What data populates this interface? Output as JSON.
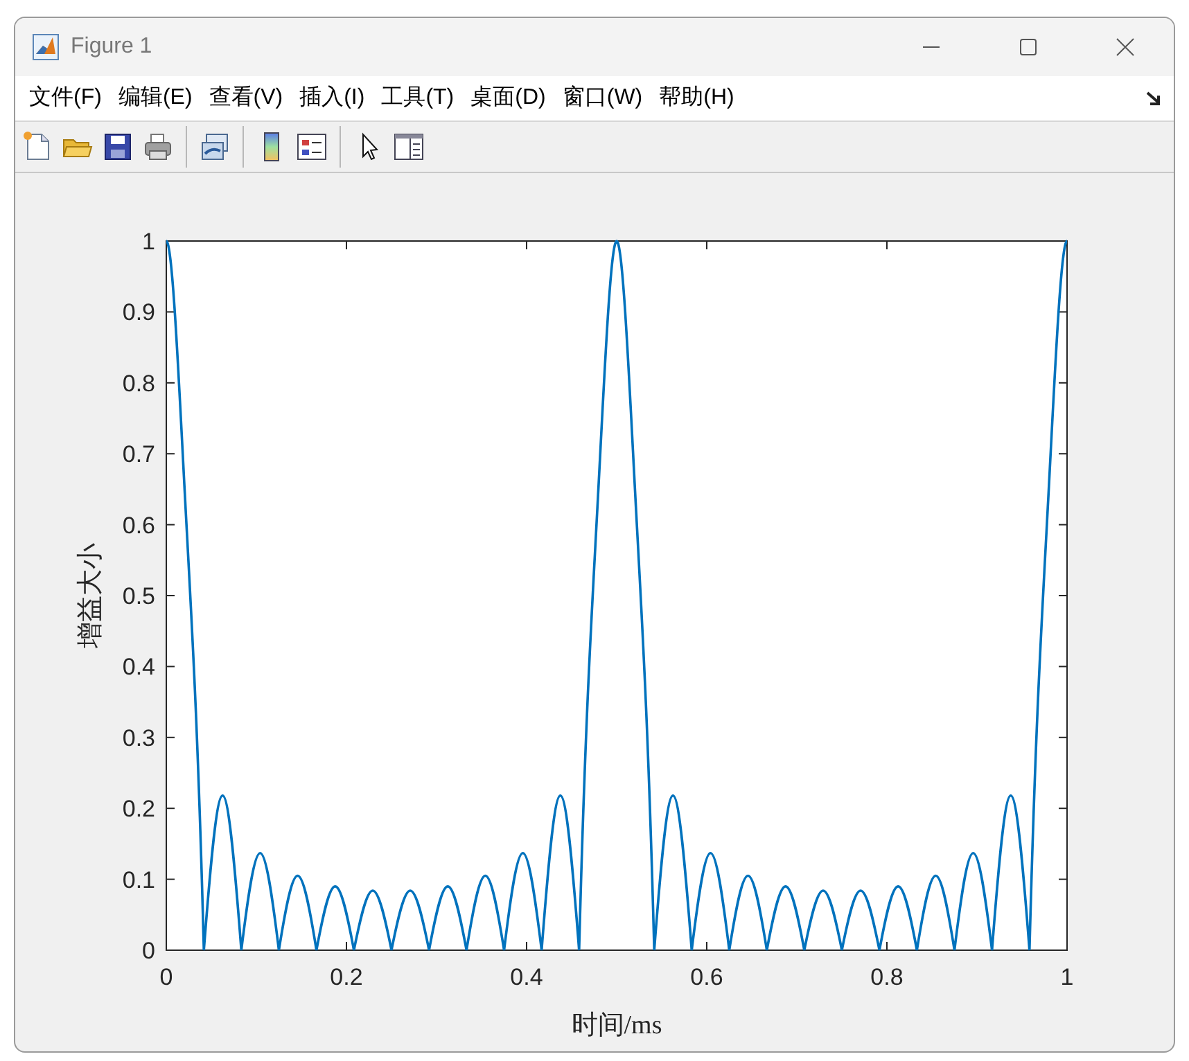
{
  "window": {
    "title": "Figure 1"
  },
  "menu": [
    "文件(F)",
    "编辑(E)",
    "查看(V)",
    "插入(I)",
    "工具(T)",
    "桌面(D)",
    "窗口(W)",
    "帮助(H)"
  ],
  "toolbar": [
    {
      "kind": "new"
    },
    {
      "kind": "open"
    },
    {
      "kind": "save"
    },
    {
      "kind": "print"
    },
    {
      "kind": "sep"
    },
    {
      "kind": "link"
    },
    {
      "kind": "sep"
    },
    {
      "kind": "colorbar"
    },
    {
      "kind": "legend"
    },
    {
      "kind": "sep"
    },
    {
      "kind": "pointer"
    },
    {
      "kind": "panel"
    }
  ],
  "chart_data": {
    "type": "line",
    "xlabel": "时间/ms",
    "ylabel": "增益大小",
    "xlim": [
      0,
      1
    ],
    "ylim": [
      0,
      1
    ],
    "xticks": [
      {
        "value": 0,
        "label": "0"
      },
      {
        "value": 0.2,
        "label": "0.2"
      },
      {
        "value": 0.4,
        "label": "0.4"
      },
      {
        "value": 0.6,
        "label": "0.6"
      },
      {
        "value": 0.8,
        "label": "0.8"
      },
      {
        "value": 1,
        "label": "1"
      }
    ],
    "yticks": [
      {
        "value": 0,
        "label": "0"
      },
      {
        "value": 0.1,
        "label": "0.1"
      },
      {
        "value": 0.2,
        "label": "0.2"
      },
      {
        "value": 0.3,
        "label": "0.3"
      },
      {
        "value": 0.4,
        "label": "0.4"
      },
      {
        "value": 0.5,
        "label": "0.5"
      },
      {
        "value": 0.6,
        "label": "0.6"
      },
      {
        "value": 0.7,
        "label": "0.7"
      },
      {
        "value": 0.8,
        "label": "0.8"
      },
      {
        "value": 0.9,
        "label": "0.9"
      },
      {
        "value": 1,
        "label": "1"
      }
    ],
    "x": [
      0,
      0.0208,
      0.0417,
      0.0625,
      0.0833,
      0.1042,
      0.125,
      0.1458,
      0.1667,
      0.1875,
      0.2083,
      0.2292,
      0.25,
      0.2708,
      0.2917,
      0.3125,
      0.3333,
      0.3542,
      0.375,
      0.3958,
      0.4167,
      0.4375,
      0.4583,
      0.4792,
      0.5,
      0.5208,
      0.5417,
      0.5625,
      0.5833,
      0.6042,
      0.625,
      0.6458,
      0.6667,
      0.6875,
      0.7083,
      0.7292,
      0.75,
      0.7708,
      0.7917,
      0.8125,
      0.8333,
      0.8542,
      0.875,
      0.8958,
      0.9167,
      0.9375,
      0.9583,
      0.9792,
      1
    ],
    "series": [
      {
        "color": "#0072bd",
        "values": [
          1,
          0.638,
          0,
          0.218,
          0,
          0.137,
          0,
          0.105,
          0,
          0.09,
          0,
          0.084,
          0,
          0.084,
          0,
          0.09,
          0,
          0.105,
          0,
          0.137,
          0,
          0.218,
          0,
          0.638,
          1,
          0.638,
          0,
          0.218,
          0,
          0.137,
          0,
          0.105,
          0,
          0.09,
          0,
          0.084,
          0,
          0.084,
          0,
          0.09,
          0,
          0.105,
          0,
          0.137,
          0,
          0.218,
          0,
          0.638,
          1
        ]
      }
    ]
  }
}
